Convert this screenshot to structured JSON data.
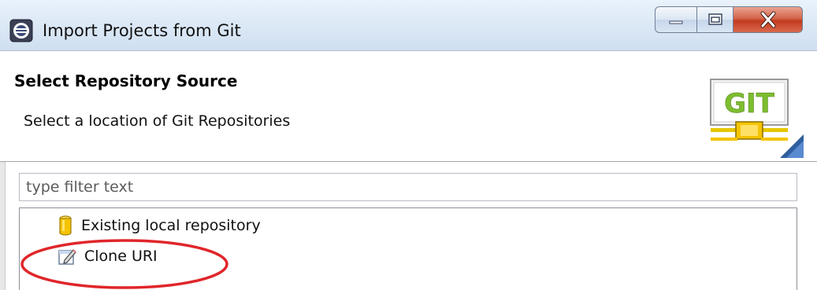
{
  "window": {
    "title": "Import Projects from Git",
    "app_icon": "eclipse-icon",
    "caption_buttons": {
      "minimize_icon": "minimize-icon",
      "maximize_icon": "maximize-icon",
      "close_icon": "close-icon",
      "close_label": "X"
    }
  },
  "banner": {
    "title": "Select Repository Source",
    "description": "Select a location of Git Repositories",
    "logo_text": "GIT",
    "logo_icon": "git-logo-icon"
  },
  "filter": {
    "placeholder": "type filter text",
    "value": ""
  },
  "tree": {
    "items": [
      {
        "label": "Existing local repository",
        "icon": "repository-cylinder-icon"
      },
      {
        "label": "Clone URI",
        "icon": "clone-uri-icon"
      }
    ]
  },
  "annotation": {
    "highlight_color": "#e0262a",
    "highlighted_item": "Clone URI"
  },
  "colors": {
    "close_button": "#c23b1f",
    "titlebar": "#dde9f6",
    "git_logo_green": "#7dbd2f",
    "repo_icon_yellow": "#f4c400"
  }
}
